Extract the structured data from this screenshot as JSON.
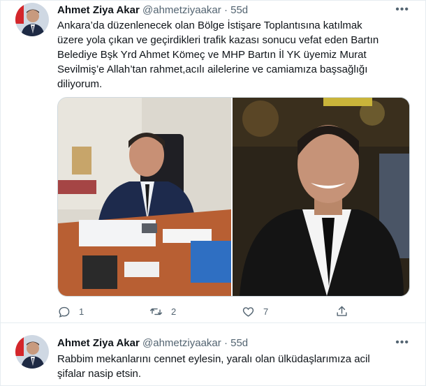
{
  "tweets": [
    {
      "author": {
        "name": "Ahmet Ziya Akar",
        "handle": "@ahmetziyaakar",
        "time": "55d"
      },
      "more": "•••",
      "lines": [
        "Ankara’da düzenlenecek olan Bölge İstişare Toplantısına katılmak",
        "üzere yola çıkan ve geçirdikleri trafik kazası sonucu vefat eden Bartın",
        "Belediye Bşk Yrd Ahmet Kömeç ve MHP Bartın İl YK üyemiz Murat",
        "Sevilmiş’e Allah’tan rahmet,acılı ailelerine ve camiamıza başsağlığı",
        "diliyorum."
      ],
      "actions": {
        "reply": "1",
        "retweet": "2",
        "like": "7"
      }
    },
    {
      "author": {
        "name": "Ahmet Ziya Akar",
        "handle": "@ahmetziyaakar",
        "time": "55d"
      },
      "more": "•••",
      "lines": [
        "Rabbim mekanlarını cennet eylesin, yaralı olan ülküdaşlarımıza acil",
        "şifalar nasip etsin."
      ]
    }
  ],
  "separator": "·",
  "icons": [
    "avatar",
    "more-icon",
    "reply-icon",
    "retweet-icon",
    "like-icon",
    "share-icon"
  ],
  "colors": {
    "text": "#0f1419",
    "secondary": "#536471",
    "border": "#e6ecf0"
  }
}
